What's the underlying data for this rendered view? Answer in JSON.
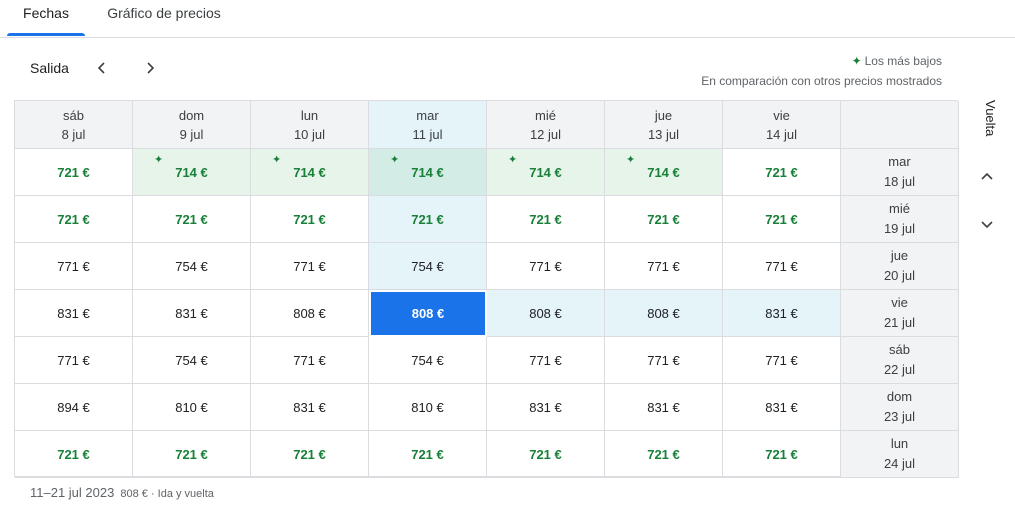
{
  "tabs": [
    {
      "label": "Fechas"
    },
    {
      "label": "Gráfico de precios"
    }
  ],
  "header": {
    "salida": "Salida"
  },
  "legend": {
    "lowest": "Los más bajos",
    "comparison": "En comparación con otros precios mostrados"
  },
  "vuelta": "Vuelta",
  "departure_dates": [
    {
      "day": "sáb",
      "date": "8 jul"
    },
    {
      "day": "dom",
      "date": "9 jul"
    },
    {
      "day": "lun",
      "date": "10 jul"
    },
    {
      "day": "mar",
      "date": "11 jul"
    },
    {
      "day": "mié",
      "date": "12 jul"
    },
    {
      "day": "jue",
      "date": "13 jul"
    },
    {
      "day": "vie",
      "date": "14 jul"
    }
  ],
  "rows": [
    {
      "day": "mar",
      "date": "18 jul",
      "prices": [
        "721 €",
        "714 €",
        "714 €",
        "714 €",
        "714 €",
        "714 €",
        "721 €"
      ]
    },
    {
      "day": "mié",
      "date": "19 jul",
      "prices": [
        "721 €",
        "721 €",
        "721 €",
        "721 €",
        "721 €",
        "721 €",
        "721 €"
      ]
    },
    {
      "day": "jue",
      "date": "20 jul",
      "prices": [
        "771 €",
        "754 €",
        "771 €",
        "754 €",
        "771 €",
        "771 €",
        "771 €"
      ]
    },
    {
      "day": "vie",
      "date": "21 jul",
      "prices": [
        "831 €",
        "831 €",
        "808 €",
        "808 €",
        "808 €",
        "808 €",
        "831 €"
      ]
    },
    {
      "day": "sáb",
      "date": "22 jul",
      "prices": [
        "771 €",
        "754 €",
        "771 €",
        "754 €",
        "771 €",
        "771 €",
        "771 €"
      ]
    },
    {
      "day": "dom",
      "date": "23 jul",
      "prices": [
        "894 €",
        "810 €",
        "831 €",
        "810 €",
        "831 €",
        "831 €",
        "831 €"
      ]
    },
    {
      "day": "lun",
      "date": "24 jul",
      "prices": [
        "721 €",
        "721 €",
        "721 €",
        "721 €",
        "721 €",
        "721 €",
        "721 €"
      ]
    }
  ],
  "footer": {
    "range": "11–21 jul 2023",
    "summary": "808 € · Ida y vuelta"
  },
  "colors": {
    "accent": "#1a73e8",
    "low_price": "#188038",
    "low_bg": "#e6f4ea",
    "selected_bg": "#e4f4f9"
  }
}
